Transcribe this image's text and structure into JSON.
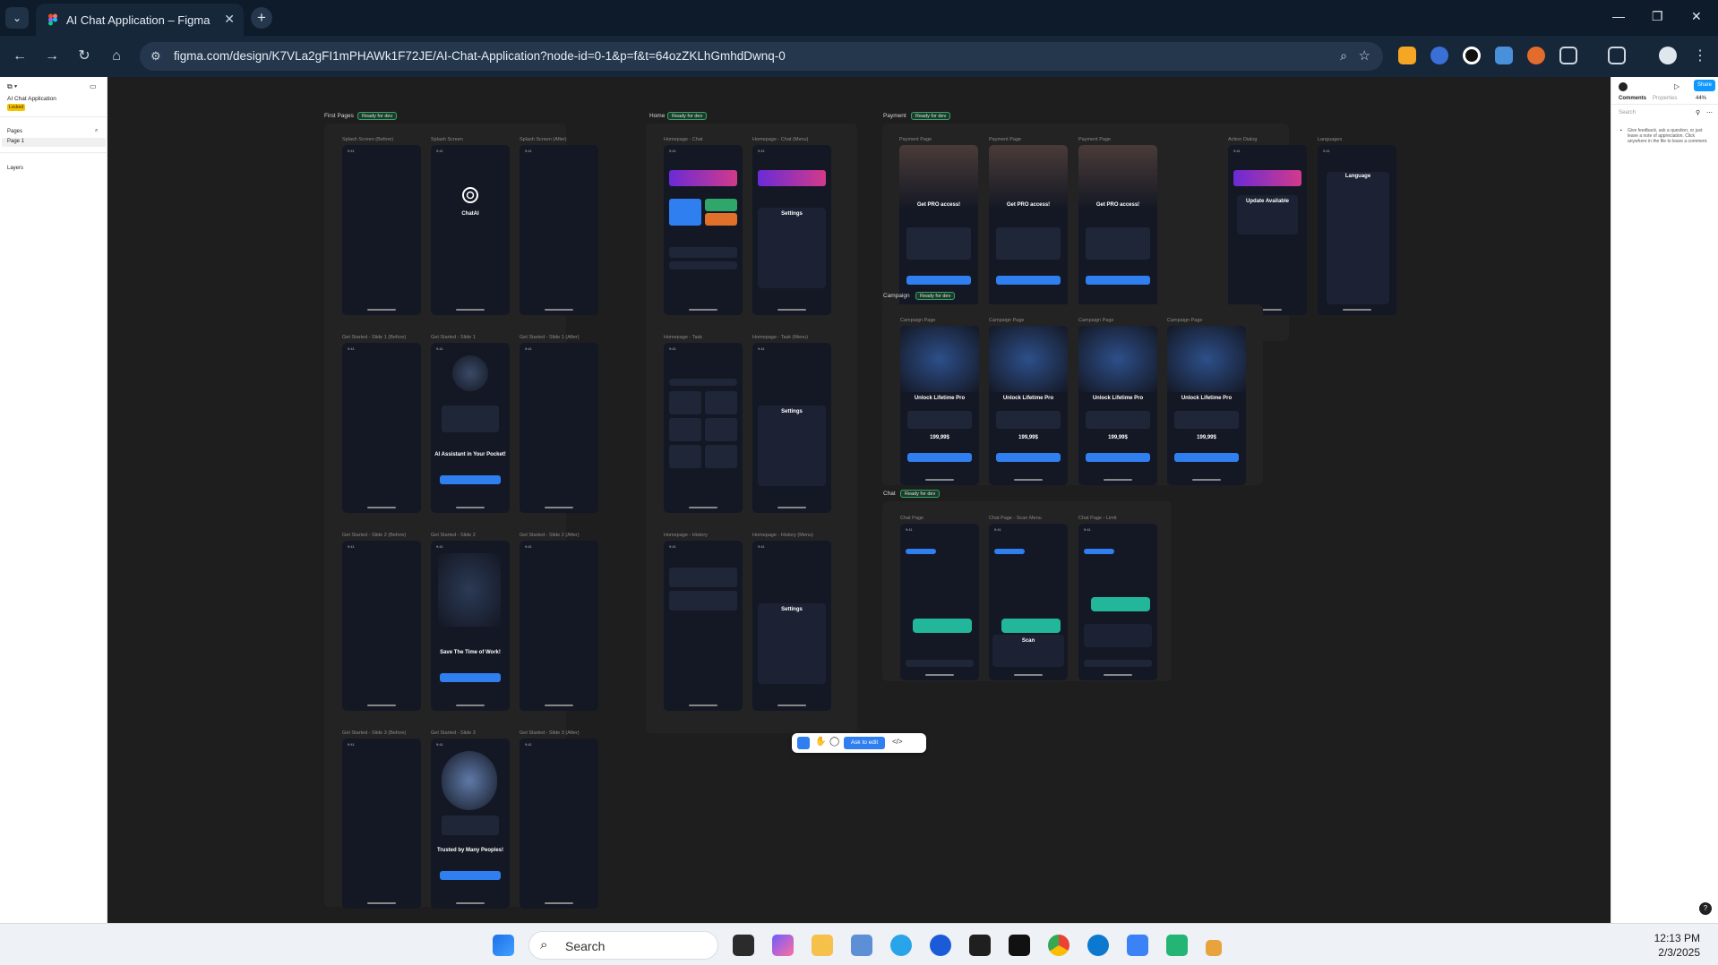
{
  "browser": {
    "tab_title": "AI Chat Application – Figma",
    "url": "figma.com/design/K7VLa2gFI1mPHAWk1F72JE/AI-Chat-Application?node-id=0-1&p=f&t=64ozZKLhGmhdDwnq-0",
    "accent": "#16273a"
  },
  "left_panel": {
    "file_name": "AI Chat Application",
    "badge": "Locked",
    "pages_label": "Pages",
    "page_item": "Page 1",
    "layers_label": "Layers"
  },
  "right_panel": {
    "share_label": "Share",
    "tabs": [
      "Comments",
      "Properties"
    ],
    "zoom": "44%",
    "search_placeholder": "Search",
    "hint": "Give feedback, ask a question, or just leave a note of appreciation. Click anywhere in the file to leave a comment."
  },
  "sections": {
    "first_pages": {
      "name": "First Pages",
      "status": "Ready for dev"
    },
    "home": {
      "name": "Home",
      "status": "Ready for dev"
    },
    "payment": {
      "name": "Payment",
      "status": "Ready for dev"
    },
    "campaign": {
      "name": "Campaign",
      "status": "Ready for dev"
    },
    "chat": {
      "name": "Chat",
      "status": "Ready for dev"
    }
  },
  "frames": {
    "first_pages": [
      "Splash Screen (Before)",
      "Splash Screen",
      "Splash Screen (After)",
      "Get Started - Slide 1 (Before)",
      "Get Started - Slide 1",
      "Get Started - Slide 1 (After)",
      "Get Started - Slide 2 (Before)",
      "Get Started - Slide 2",
      "Get Started - Slide 2 (After)",
      "Get Started - Slide 3 (Before)",
      "Get Started - Slide 3",
      "Get Started - Slide 3 (After)"
    ],
    "home": [
      "Homepage - Chat",
      "Homepage - Chat (Menu)",
      "Homepage - Task",
      "Homepage - Task (Menu)",
      "Homepage - History",
      "Homepage - History (Menu)"
    ],
    "payment": [
      "Payment Page",
      "Payment Page",
      "Payment Page",
      "Action Dialog",
      "Languages"
    ],
    "campaign": [
      "Campaign Page",
      "Campaign Page",
      "Campaign Page",
      "Campaign Page"
    ],
    "chat": [
      "Chat Page",
      "Chat Page - Scan Menu",
      "Chat Page - Limit"
    ]
  },
  "screen_text": {
    "chatai": "ChatAI",
    "slide1_title": "AI Assistant in Your Pocket!",
    "slide2_title": "Save The Time of Work!",
    "slide3_title": "Trusted by Many Peoples!",
    "get_pro": "Get PRO access!",
    "unlock": "Unlock Lifetime Pro",
    "price": "199,99$",
    "settings": "Settings",
    "language": "Language",
    "update": "Update Available",
    "scan": "Scan"
  },
  "toolbar": {
    "ask_to_edit": "Ask to edit"
  },
  "taskbar": {
    "search_label": "Search",
    "time": "12:13 PM",
    "date": "2/3/2025"
  }
}
